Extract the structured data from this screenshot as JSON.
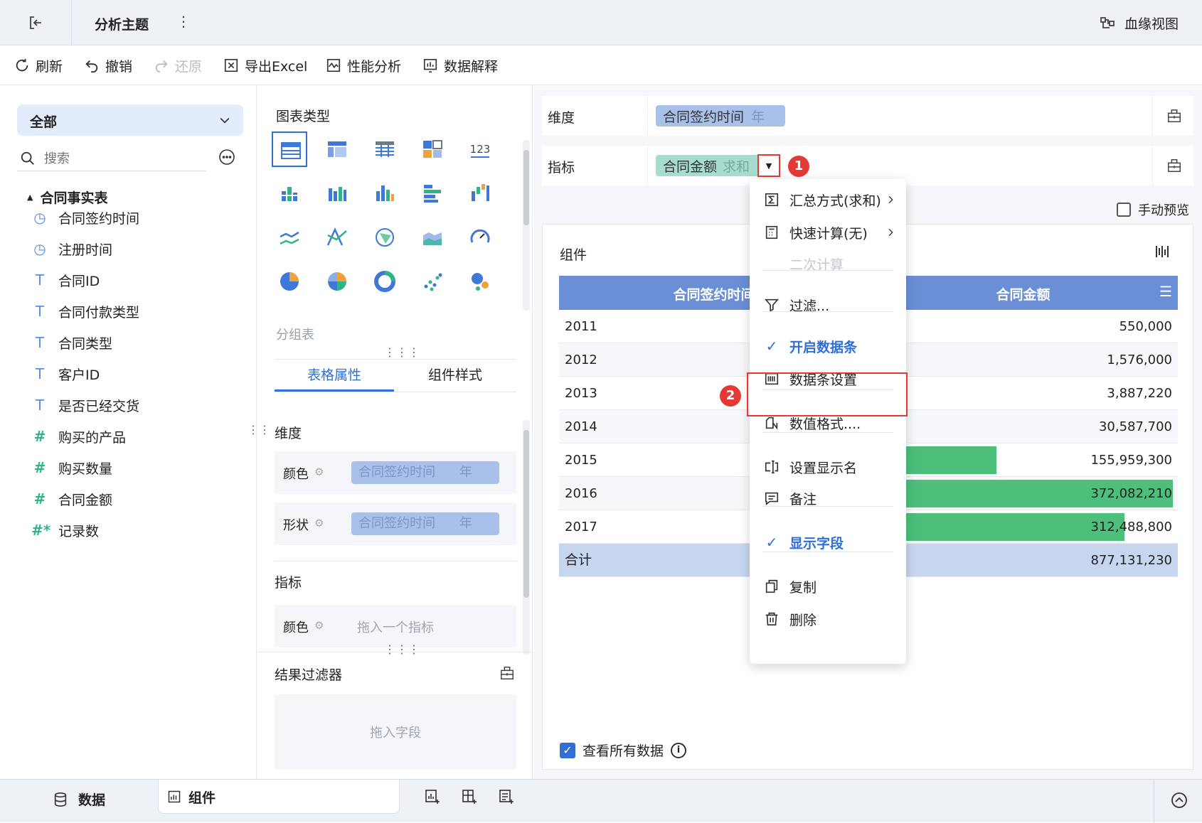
{
  "header": {
    "title": "分析主题",
    "lineage_label": "血缘视图"
  },
  "toolbar": {
    "refresh": "刷新",
    "undo": "撤销",
    "redo": "还原",
    "export": "导出Excel",
    "perf": "性能分析",
    "explain": "数据解释"
  },
  "left": {
    "scope": "全部",
    "search_placeholder": "搜索",
    "table_name": "合同事实表",
    "fields": [
      {
        "label": "合同签约时间",
        "icon": "clock-icon"
      },
      {
        "label": "注册时间",
        "icon": "clock-icon"
      },
      {
        "label": "合同ID",
        "icon": "text-type-icon"
      },
      {
        "label": "合同付款类型",
        "icon": "text-type-icon"
      },
      {
        "label": "合同类型",
        "icon": "text-type-icon"
      },
      {
        "label": "客户ID",
        "icon": "text-type-icon"
      },
      {
        "label": "是否已经交货",
        "icon": "text-type-icon"
      },
      {
        "label": "购买的产品",
        "icon": "hash-icon"
      },
      {
        "label": "购买数量",
        "icon": "hash-icon"
      },
      {
        "label": "合同金额",
        "icon": "hash-icon"
      },
      {
        "label": "记录数",
        "icon": "hash-star-icon"
      }
    ]
  },
  "mid": {
    "chart_type_title": "图表类型",
    "group_table_label": "分组表",
    "tabs": [
      "表格属性",
      "组件样式"
    ],
    "dimension_label": "维度",
    "color_label": "颜色",
    "shape_label": "形状",
    "dim_chip_field": "合同签约时间",
    "dim_chip_unit": "年",
    "metric_label": "指标",
    "metric_color_label": "颜色",
    "metric_drop_hint": "拖入一个指标",
    "result_filter_title": "结果过滤器",
    "filter_drop_hint": "拖入字段"
  },
  "right": {
    "dimension_label": "维度",
    "dimension_chip_field": "合同签约时间",
    "dimension_chip_unit": "年",
    "metric_label": "指标",
    "metric_chip_field": "合同金额",
    "metric_chip_agg": "求和",
    "manual_preview": "手动预览",
    "component_title": "组件",
    "table": {
      "columns": [
        "合同签约时间",
        "合同金额"
      ],
      "rows": [
        {
          "year": "2011",
          "amount": "550,000",
          "value": 550000
        },
        {
          "year": "2012",
          "amount": "1,576,000",
          "value": 1576000
        },
        {
          "year": "2013",
          "amount": "3,887,220",
          "value": 3887220
        },
        {
          "year": "2014",
          "amount": "30,587,700",
          "value": 30587700
        },
        {
          "year": "2015",
          "amount": "155,959,300",
          "value": 155959300
        },
        {
          "year": "2016",
          "amount": "372,082,210",
          "value": 372082210
        },
        {
          "year": "2017",
          "amount": "312,488,800",
          "value": 312488800
        }
      ],
      "total_label": "合计",
      "total_amount": "877,131,230"
    },
    "view_all_label": "查看所有数据"
  },
  "context_menu": {
    "items": [
      {
        "label": "汇总方式(求和)",
        "icon": "sigma-icon",
        "submenu": true
      },
      {
        "label": "快速计算(无)",
        "icon": "calculator-icon",
        "submenu": true
      },
      {
        "label": "二次计算",
        "disabled": true
      },
      {
        "label": "过滤...",
        "icon": "filter-icon"
      },
      {
        "label": "开启数据条",
        "checked": true
      },
      {
        "label": "数据条设置",
        "icon": "databar-icon",
        "highlighted": true
      },
      {
        "label": "数值格式....",
        "icon": "number-format-icon"
      },
      {
        "label": "设置显示名",
        "icon": "rename-icon"
      },
      {
        "label": "备注",
        "icon": "comment-icon"
      },
      {
        "label": "显示字段",
        "checked": true
      },
      {
        "label": "复制",
        "icon": "copy-icon"
      },
      {
        "label": "删除",
        "icon": "trash-icon"
      }
    ]
  },
  "callouts": [
    "1",
    "2"
  ],
  "bottom": {
    "data_tab": "数据",
    "component_tab": "组件"
  },
  "colors": {
    "accent": "#2f6fd6",
    "header_blue": "#6a8fd6",
    "bar_green": "#4cbf7b",
    "chip_blue": "#a9c0ea",
    "chip_teal": "#a7dccf",
    "callout_red": "#e53935"
  }
}
